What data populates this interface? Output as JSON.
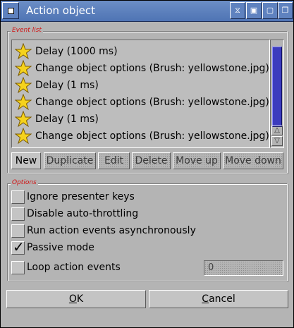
{
  "window": {
    "title": "Action object",
    "gadgets": {
      "iconify": "⧖",
      "zoom": "▣",
      "depth": "❐"
    }
  },
  "event_list": {
    "label": "Event list",
    "items": [
      {
        "icon": "star-icon",
        "label": "Delay (1000 ms)"
      },
      {
        "icon": "star-icon",
        "label": "Change object options (Brush: yellowstone.jpg)"
      },
      {
        "icon": "star-icon",
        "label": "Delay (1 ms)"
      },
      {
        "icon": "star-icon",
        "label": "Change object options (Brush: yellowstone.jpg)"
      },
      {
        "icon": "star-icon",
        "label": "Delay (1 ms)"
      },
      {
        "icon": "star-icon",
        "label": "Change object options (Brush: yellowstone.jpg)"
      }
    ],
    "scroll_up": "△",
    "scroll_down": "▽"
  },
  "list_buttons": {
    "new": "New",
    "duplicate": "Duplicate",
    "edit": "Edit",
    "delete": "Delete",
    "move_up": "Move up",
    "move_down": "Move down"
  },
  "options": {
    "label": "Options",
    "ignore_presenter_keys": {
      "label": "Ignore presenter keys",
      "checked": false
    },
    "disable_auto_throttling": {
      "label": "Disable auto-throttling",
      "checked": false
    },
    "run_async": {
      "label": "Run action events asynchronously",
      "checked": false
    },
    "passive_mode": {
      "label": "Passive mode",
      "checked": true
    },
    "loop_action_events": {
      "label": "Loop action events",
      "checked": false,
      "count": "0"
    }
  },
  "footer": {
    "ok_underlined": "O",
    "ok_rest": "K",
    "cancel_underlined": "C",
    "cancel_rest": "ancel"
  },
  "checkmark": "✓"
}
